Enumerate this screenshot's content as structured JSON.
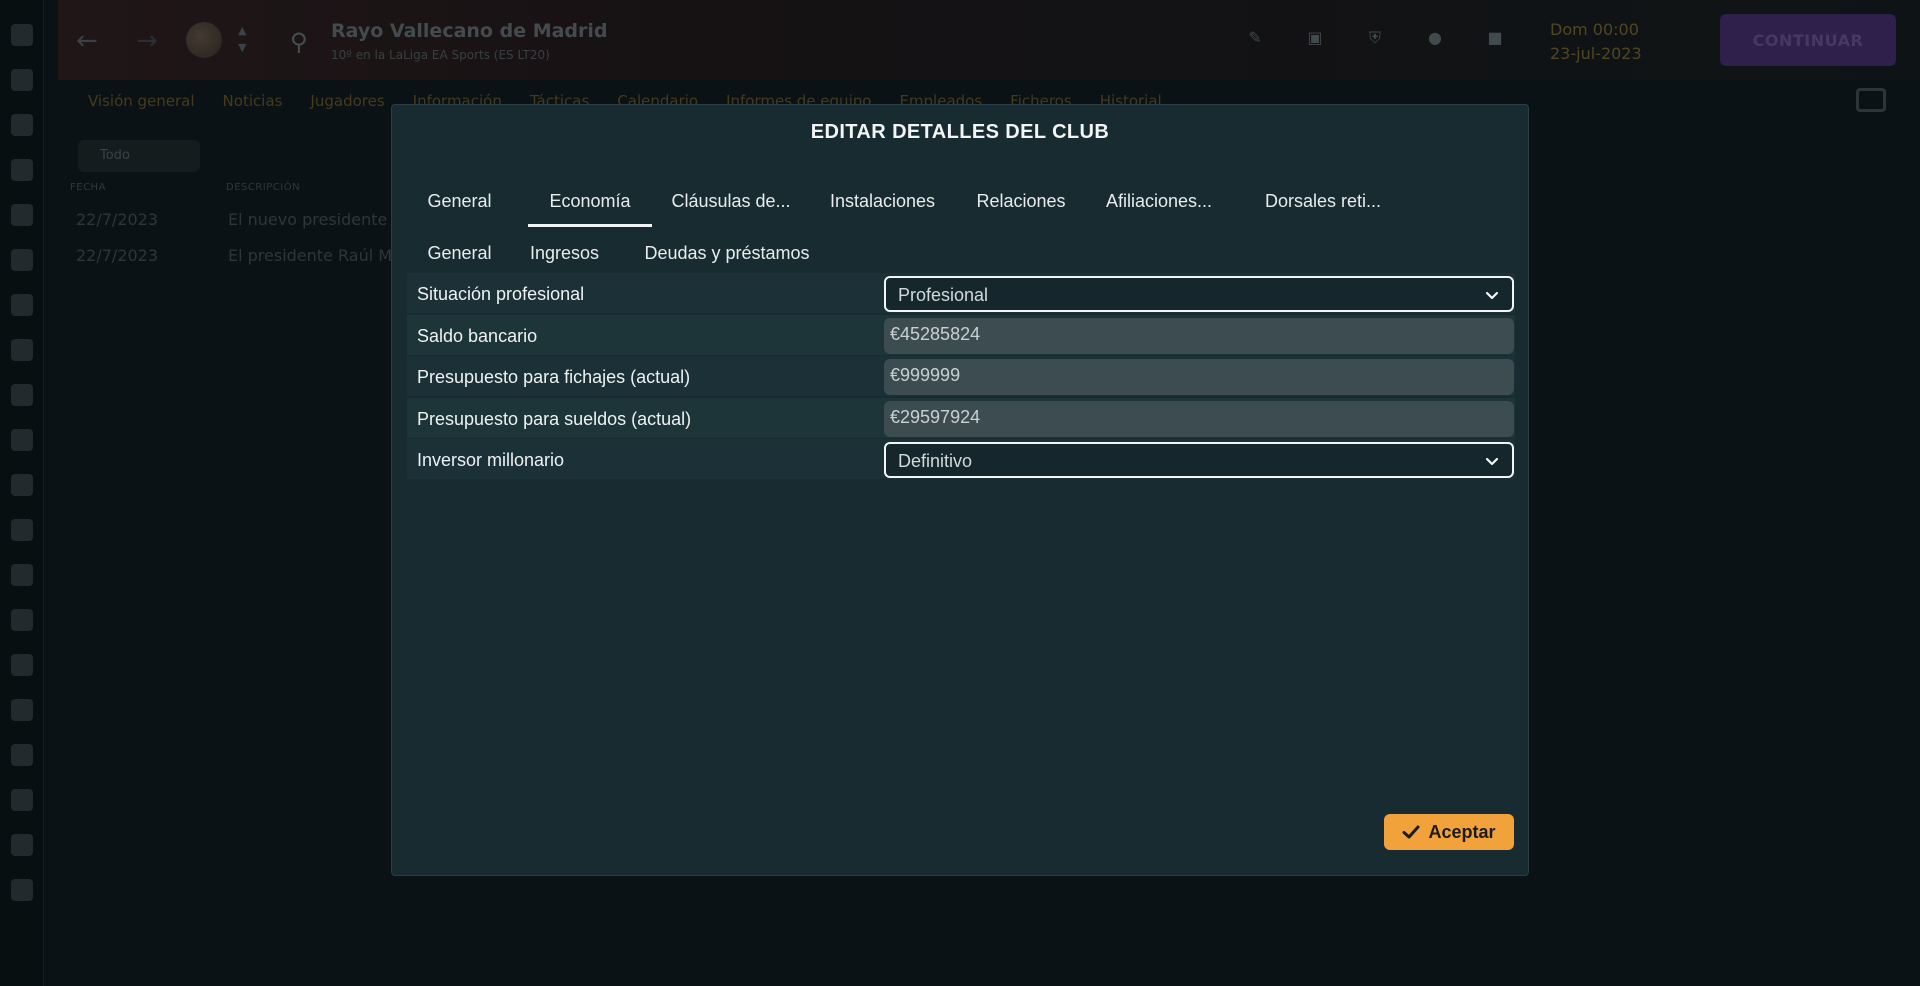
{
  "background": {
    "club_name": "Rayo Vallecano de Madrid",
    "club_subtitle": "10º en la LaLiga EA Sports (ES LT20)",
    "date_line1": "Dom 00:00",
    "date_line2": "23-jul-2023",
    "continue_label": "CONTINUAR",
    "menu": [
      "Visión general",
      "Noticias",
      "Jugadores",
      "Información",
      "Tácticas",
      "Calendario",
      "Informes de equipo",
      "Empleados",
      "Ficheros",
      "Historial"
    ],
    "filter_label": "Todo",
    "table_headers": {
      "date": "FECHA",
      "description": "DESCRIPCIÓN"
    },
    "rows": [
      {
        "date": "22/7/2023",
        "description": "El nuevo presidente"
      },
      {
        "date": "22/7/2023",
        "description": "El presidente Raúl Ma"
      }
    ]
  },
  "modal": {
    "title": "EDITAR DETALLES DEL CLUB",
    "tabs": [
      {
        "label": "General"
      },
      {
        "label": "Economía"
      },
      {
        "label": "Cláusulas de..."
      },
      {
        "label": "Instalaciones"
      },
      {
        "label": "Relaciones"
      },
      {
        "label": "Afiliaciones..."
      },
      {
        "label": "Dorsales reti..."
      }
    ],
    "active_tab": "Economía",
    "subtabs": [
      {
        "label": "General"
      },
      {
        "label": "Ingresos"
      },
      {
        "label": "Deudas y préstamos"
      }
    ],
    "active_subtab": "General",
    "fields": {
      "professional_status": {
        "label": "Situación profesional",
        "value": "Profesional"
      },
      "bank_balance": {
        "label": "Saldo bancario",
        "value": "€45285824"
      },
      "transfer_budget": {
        "label": "Presupuesto para fichajes (actual)",
        "value": "€999999"
      },
      "wage_budget": {
        "label": "Presupuesto para sueldos (actual)",
        "value": "€29597924"
      },
      "millionaire_investor": {
        "label": "Inversor millonario",
        "value": "Definitivo"
      }
    },
    "accept_label": "Aceptar"
  },
  "colors": {
    "modal_bg": "#172b31",
    "accent_button": "#f2a23a",
    "continue_button": "#3e2660",
    "input_bg": "#3c4c51"
  },
  "icons": {
    "chevron": "chevron-down-icon",
    "accept": "check-icon",
    "search": "search-icon"
  }
}
